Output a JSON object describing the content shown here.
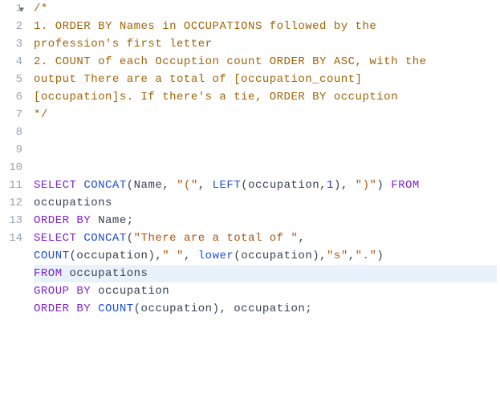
{
  "gutterNumbers": [
    "1",
    "2",
    "3",
    "4",
    "5",
    "6",
    "7",
    "8",
    "9",
    "10",
    "11",
    "12",
    "13",
    "14"
  ],
  "gutterWraps": {
    "1": 0,
    "2": 1,
    "3": 2,
    "4": 0,
    "5": 0,
    "6": 0,
    "7": 0,
    "8": 1,
    "9": 0,
    "10": 1,
    "11": 0,
    "12": 0,
    "13": 0,
    "14": 0
  },
  "foldOnLine": "1",
  "foldGlyph": "▼",
  "c": {
    "l1": "/*",
    "l2a": "1. ORDER BY Names in OCCUPATIONS followed by the ",
    "l2b": "profession's first letter",
    "l3a": "2. COUNT of each Occuption count ORDER BY ASC, with the ",
    "l3b": "output There are a total of [occupation_count] ",
    "l3c": "[occupation]s. If there's a tie, ORDER BY occuption",
    "l4": "*/"
  },
  "k": {
    "select": "SELECT",
    "from": "FROM",
    "orderby": "ORDER BY",
    "groupby": "GROUP BY"
  },
  "f": {
    "concat": "CONCAT",
    "left": "LEFT",
    "count": "COUNT",
    "lower": "lower"
  },
  "id": {
    "name": "Name",
    "occ": "occupation",
    "occs": "occupations"
  },
  "s": {
    "lp": "\"(\"",
    "rp": "\")\"",
    "total": "\"There are a total of \"",
    "sp": "\" \"",
    "ss": "\"s\"",
    "dot": "\".\""
  },
  "n": {
    "one": "1"
  },
  "activeLine": 11
}
